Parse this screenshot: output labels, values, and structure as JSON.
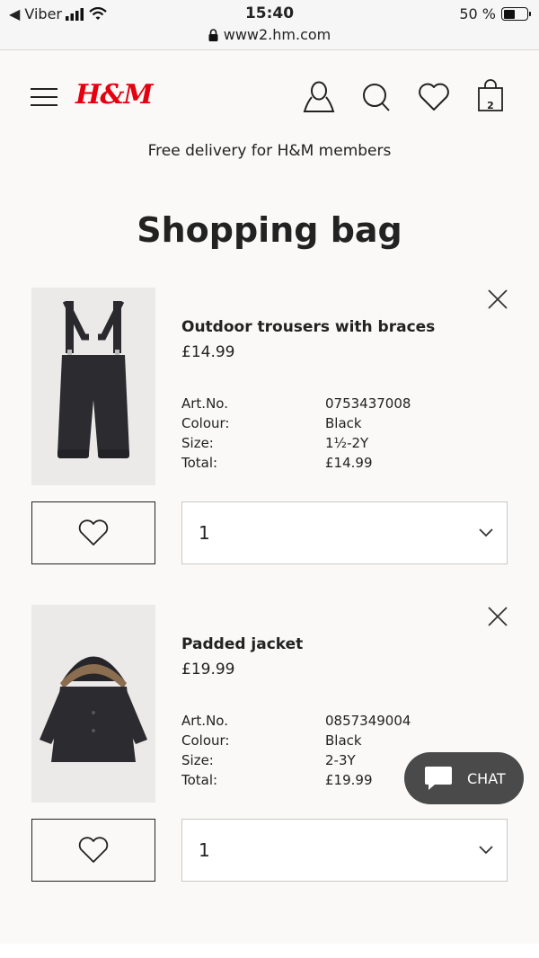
{
  "status_bar": {
    "back_app": "◀ Viber",
    "time": "15:40",
    "url": "www2.hm.com",
    "battery": "50 %",
    "battery_level": 0.5
  },
  "header": {
    "logo": "H&M",
    "bag_count": "2",
    "promo": "Free delivery for H&M members"
  },
  "page_title": "Shopping bag",
  "labels": {
    "art_no": "Art.No.",
    "colour": "Colour:",
    "size": "Size:",
    "total": "Total:"
  },
  "items": [
    {
      "name": "Outdoor trousers with braces",
      "price": "£14.99",
      "art_no": "0753437008",
      "colour": "Black",
      "size": "1½-2Y",
      "total": "£14.99",
      "quantity": "1"
    },
    {
      "name": "Padded jacket",
      "price": "£19.99",
      "art_no": "0857349004",
      "colour": "Black",
      "size": "2-3Y",
      "total": "£19.99",
      "quantity": "1"
    }
  ],
  "chat": {
    "label": "CHAT"
  }
}
